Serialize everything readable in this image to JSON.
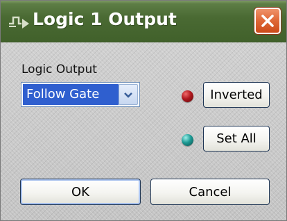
{
  "window": {
    "title": "Logic 1 Output",
    "icon": "logic-signal-icon",
    "close_icon": "close-icon"
  },
  "logic_output": {
    "label": "Logic Output",
    "selected_value": "Follow Gate"
  },
  "indicators": {
    "inverted_led_color": "#a8181c",
    "set_all_led_color": "#1d8a86"
  },
  "buttons": {
    "inverted_label": "Inverted",
    "set_all_label": "Set All",
    "ok_label": "OK",
    "cancel_label": "Cancel"
  },
  "colors": {
    "titlebar": "#4a6a33",
    "close_button": "#e06a3a",
    "selection": "#2f5fcf",
    "button_border": "#1e3554"
  }
}
